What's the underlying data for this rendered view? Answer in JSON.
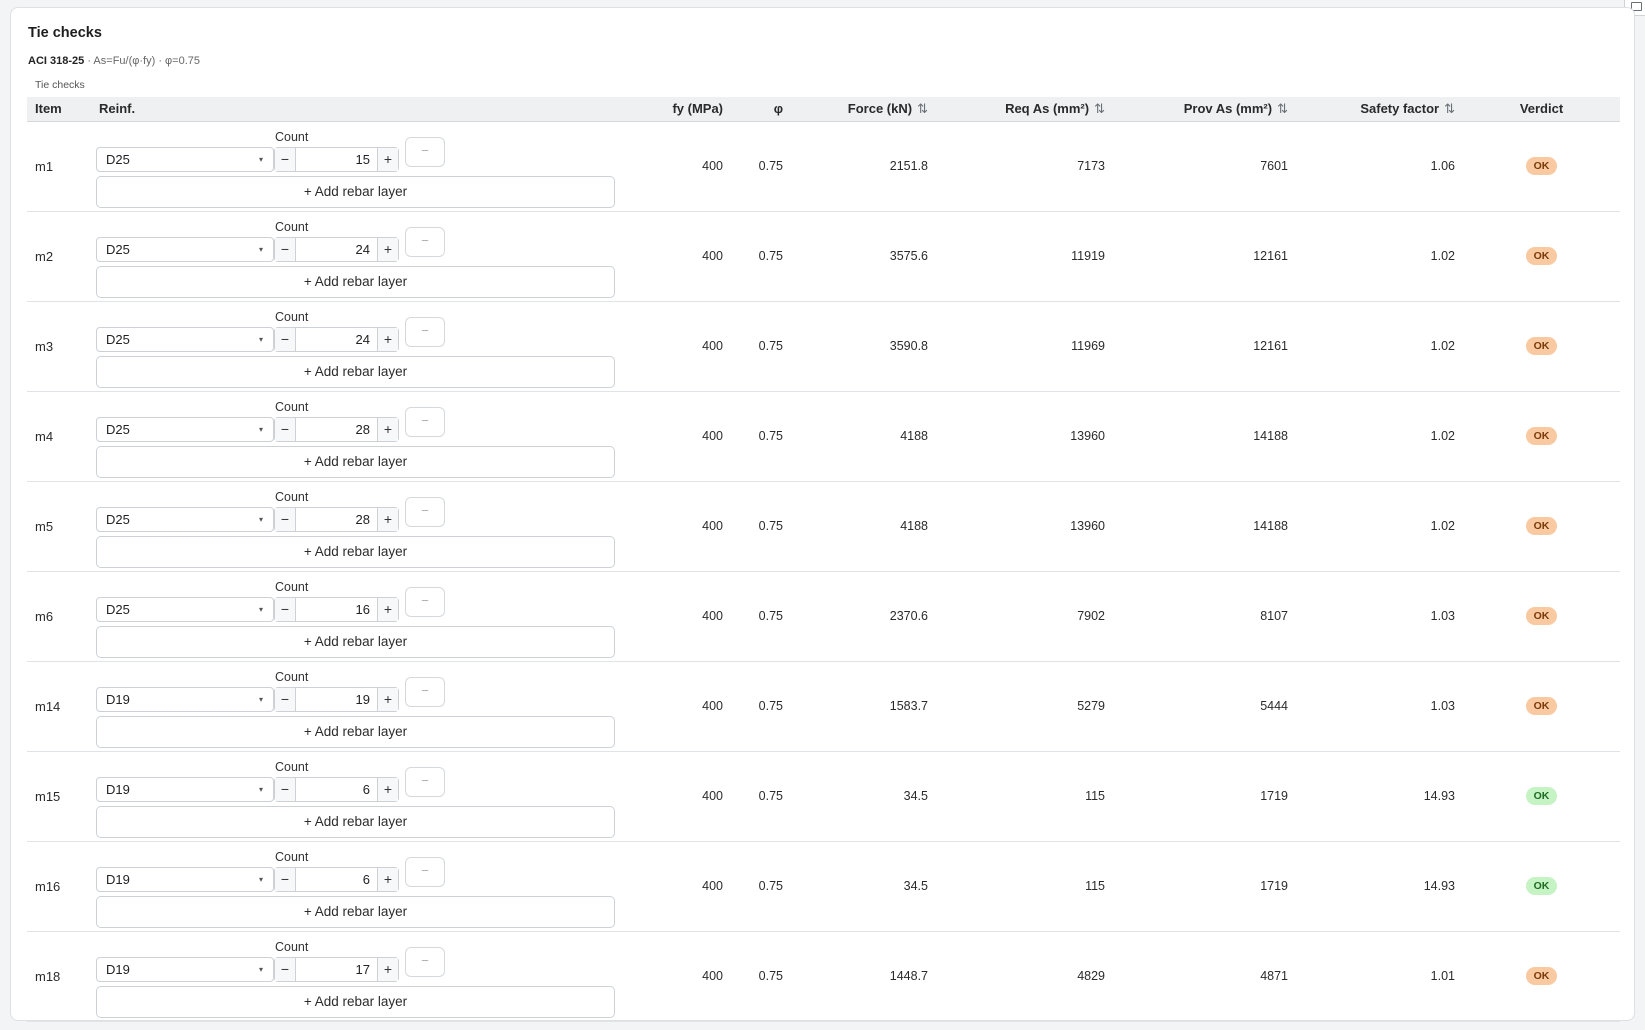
{
  "panel": {
    "title": "Tie checks",
    "code": "ACI 318-25",
    "formula": " · As=Fu/(φ·fy) · φ=0.75",
    "caption": "Tie checks"
  },
  "columns": {
    "item": "Item",
    "reinf": "Reinf.",
    "fy": "fy (MPa)",
    "phi": "φ",
    "force": "Force (kN)",
    "req_as": "Req As (mm²)",
    "prov_as": "Prov As (mm²)",
    "safety": "Safety factor",
    "verdict": "Verdict"
  },
  "labels": {
    "count": "Count",
    "add_layer": "+ Add rebar layer",
    "remove_layer": "−",
    "minus": "−",
    "plus": "+",
    "sort": "⇅",
    "caret": "▾"
  },
  "colors": {
    "warn_badge": "#f9c9a1",
    "ok_badge": "#c6f3c4"
  },
  "rows": [
    {
      "item": "m1",
      "bar": "D25",
      "count": "15",
      "fy": "400",
      "phi": "0.75",
      "force": "2151.8",
      "req": "7173",
      "prov": "7601",
      "sf": "1.06",
      "verdict": "OK",
      "status": "warn"
    },
    {
      "item": "m2",
      "bar": "D25",
      "count": "24",
      "fy": "400",
      "phi": "0.75",
      "force": "3575.6",
      "req": "11919",
      "prov": "12161",
      "sf": "1.02",
      "verdict": "OK",
      "status": "warn"
    },
    {
      "item": "m3",
      "bar": "D25",
      "count": "24",
      "fy": "400",
      "phi": "0.75",
      "force": "3590.8",
      "req": "11969",
      "prov": "12161",
      "sf": "1.02",
      "verdict": "OK",
      "status": "warn"
    },
    {
      "item": "m4",
      "bar": "D25",
      "count": "28",
      "fy": "400",
      "phi": "0.75",
      "force": "4188",
      "req": "13960",
      "prov": "14188",
      "sf": "1.02",
      "verdict": "OK",
      "status": "warn"
    },
    {
      "item": "m5",
      "bar": "D25",
      "count": "28",
      "fy": "400",
      "phi": "0.75",
      "force": "4188",
      "req": "13960",
      "prov": "14188",
      "sf": "1.02",
      "verdict": "OK",
      "status": "warn"
    },
    {
      "item": "m6",
      "bar": "D25",
      "count": "16",
      "fy": "400",
      "phi": "0.75",
      "force": "2370.6",
      "req": "7902",
      "prov": "8107",
      "sf": "1.03",
      "verdict": "OK",
      "status": "warn"
    },
    {
      "item": "m14",
      "bar": "D19",
      "count": "19",
      "fy": "400",
      "phi": "0.75",
      "force": "1583.7",
      "req": "5279",
      "prov": "5444",
      "sf": "1.03",
      "verdict": "OK",
      "status": "warn"
    },
    {
      "item": "m15",
      "bar": "D19",
      "count": "6",
      "fy": "400",
      "phi": "0.75",
      "force": "34.5",
      "req": "115",
      "prov": "1719",
      "sf": "14.93",
      "verdict": "OK",
      "status": "good"
    },
    {
      "item": "m16",
      "bar": "D19",
      "count": "6",
      "fy": "400",
      "phi": "0.75",
      "force": "34.5",
      "req": "115",
      "prov": "1719",
      "sf": "14.93",
      "verdict": "OK",
      "status": "good"
    },
    {
      "item": "m18",
      "bar": "D19",
      "count": "17",
      "fy": "400",
      "phi": "0.75",
      "force": "1448.7",
      "req": "4829",
      "prov": "4871",
      "sf": "1.01",
      "verdict": "OK",
      "status": "warn"
    }
  ]
}
